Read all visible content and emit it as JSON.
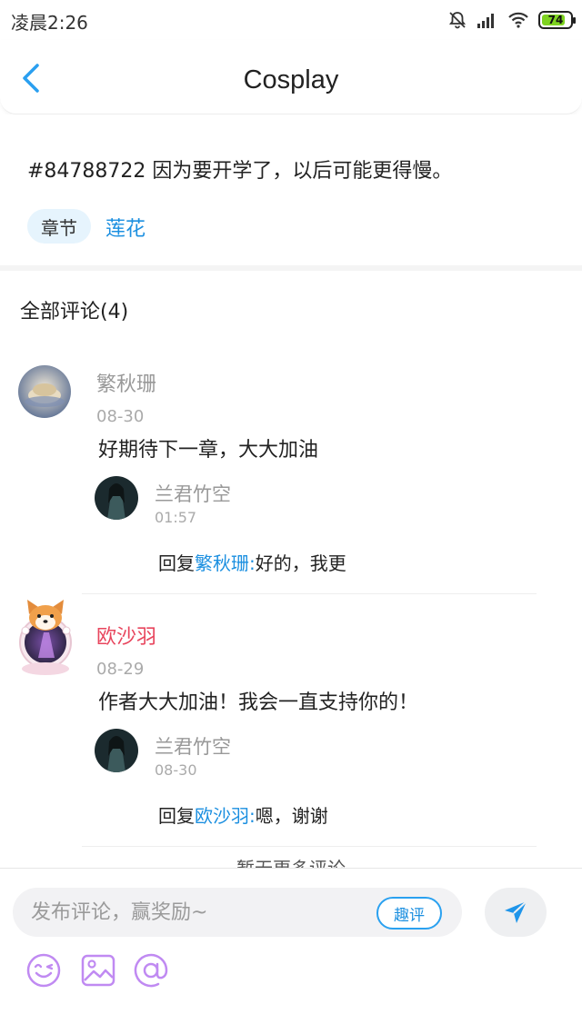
{
  "status": {
    "time": "凌晨2:26",
    "battery": "74"
  },
  "header": {
    "title": "Cosplay"
  },
  "post": {
    "text": "#84788722 因为要开学了，以后可能更得慢。",
    "chapter_tag": "章节",
    "chapter_name": "莲花"
  },
  "comments": {
    "heading": "全部评论(4)",
    "items": [
      {
        "user": "繁秋珊",
        "date": "08-30",
        "text": "好期待下一章，大大加油",
        "reply": {
          "user": "兰君竹空",
          "date": "01:57",
          "prefix": "回复",
          "target": "繁秋珊:",
          "text": "好的，我更"
        }
      },
      {
        "user": "欧沙羽",
        "date": "08-29",
        "text": "作者大大加油！我会一直支持你的！",
        "reply": {
          "user": "兰君竹空",
          "date": "08-30",
          "prefix": "回复",
          "target": "欧沙羽:",
          "text": "嗯，谢谢"
        }
      }
    ],
    "more": "暂无更多评论"
  },
  "composer": {
    "placeholder": "发布评论，赢奖励~",
    "qu_label": "趣评"
  },
  "colors": {
    "accent": "#1b8fe0",
    "vip_name": "#e8455d"
  }
}
